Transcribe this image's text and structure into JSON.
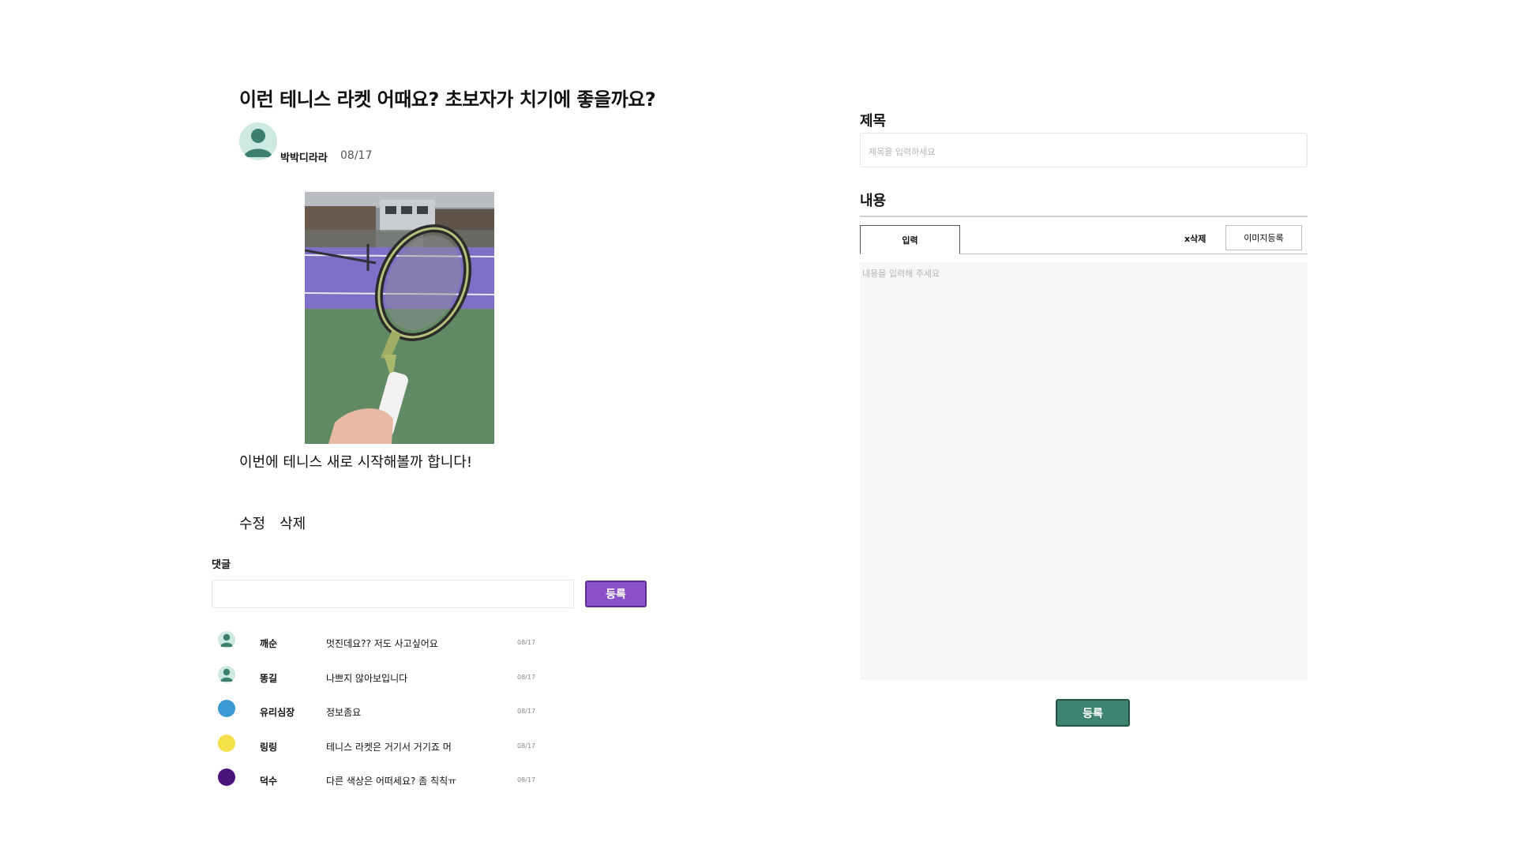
{
  "post": {
    "title": "이런 테니스 라켓 어때요? 초보자가 치기에 좋을까요?",
    "author": "박박디라라",
    "date": "08/17",
    "body": "이번에 테니스 새로 시작해볼까 합니다!",
    "edit_label": "수정",
    "delete_label": "삭제",
    "avatar_color": "#3d7f6d"
  },
  "comments": {
    "heading": "댓글",
    "submit_label": "등록",
    "submit_color": "#8a4fc9",
    "items": [
      {
        "name": "깨순",
        "text": "멋진데요?? 저도 사고싶어요",
        "date": "08/17",
        "avatar": "person",
        "color": "#3d7f6d"
      },
      {
        "name": "똥길",
        "text": "나쁘지 않아보입니다",
        "date": "08/17",
        "avatar": "person",
        "color": "#3d7f6d"
      },
      {
        "name": "유리심장",
        "text": "정보좀요",
        "date": "08/17",
        "avatar": "circle",
        "color": "#3b9ad4"
      },
      {
        "name": "링링",
        "text": "테니스 라켓은 거기서 거기죠 머",
        "date": "08/17",
        "avatar": "circle",
        "color": "#f4e04a"
      },
      {
        "name": "덕수",
        "text": "다른 색상은 어떠세요? 좀 칙칙ㅠ",
        "date": "08/17",
        "avatar": "circle",
        "color": "#4a137a"
      }
    ]
  },
  "form": {
    "title_label": "제목",
    "title_placeholder": "제목을 입력하세요",
    "content_label": "내용",
    "tab_input_label": "입력",
    "delete_label": "x삭제",
    "image_upload_label": "이미지등록",
    "content_placeholder": "내용을 입력해 주세요",
    "submit_label": "등록",
    "submit_color": "#3f8470"
  }
}
